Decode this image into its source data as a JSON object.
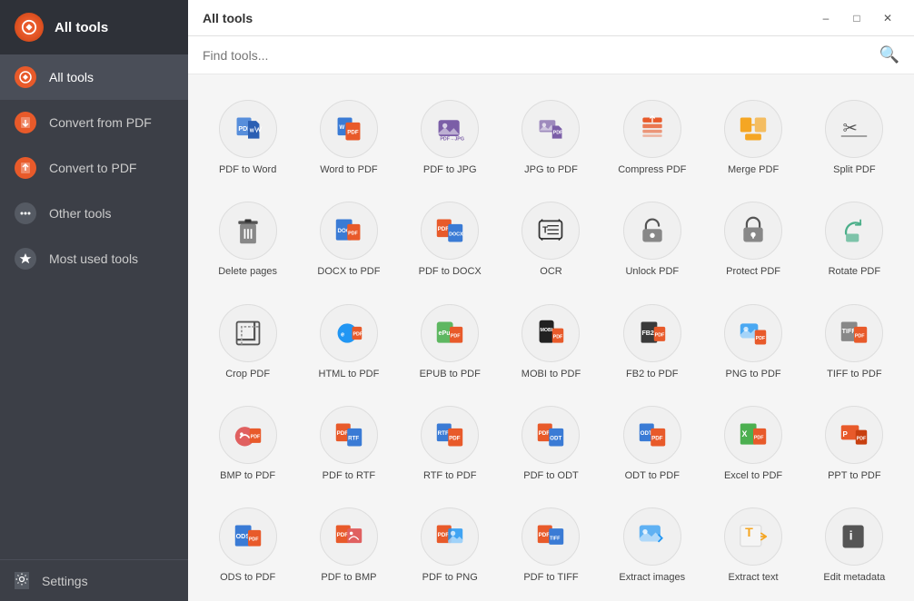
{
  "sidebar": {
    "logo_text": "All tools",
    "items": [
      {
        "id": "all-tools",
        "label": "All tools",
        "active": true
      },
      {
        "id": "convert-from-pdf",
        "label": "Convert from PDF",
        "active": false
      },
      {
        "id": "convert-to-pdf",
        "label": "Convert to PDF",
        "active": false
      },
      {
        "id": "other-tools",
        "label": "Other tools",
        "active": false
      },
      {
        "id": "most-used-tools",
        "label": "Most used tools",
        "active": false
      }
    ],
    "settings_label": "Settings"
  },
  "titlebar": {
    "title": "All tools",
    "minimize": "–",
    "maximize": "□",
    "close": "✕"
  },
  "search": {
    "placeholder": "Find tools..."
  },
  "tools": [
    {
      "id": "pdf-to-word",
      "label": "PDF to Word",
      "color": "#3a7bd5"
    },
    {
      "id": "word-to-pdf",
      "label": "Word to PDF",
      "color": "#3a7bd5"
    },
    {
      "id": "pdf-to-jpg",
      "label": "PDF to JPG",
      "color": "#7b5ea7"
    },
    {
      "id": "jpg-to-pdf",
      "label": "JPG to PDF",
      "color": "#7b5ea7"
    },
    {
      "id": "compress-pdf",
      "label": "Compress PDF",
      "color": "#e85a2a"
    },
    {
      "id": "merge-pdf",
      "label": "Merge PDF",
      "color": "#f5a623"
    },
    {
      "id": "split-pdf",
      "label": "Split PDF",
      "color": "#555"
    },
    {
      "id": "delete-pages",
      "label": "Delete pages",
      "color": "#555"
    },
    {
      "id": "docx-to-pdf",
      "label": "DOCX to PDF",
      "color": "#3a7bd5"
    },
    {
      "id": "pdf-to-docx",
      "label": "PDF to DOCX",
      "color": "#3a7bd5"
    },
    {
      "id": "ocr",
      "label": "OCR",
      "color": "#333"
    },
    {
      "id": "unlock-pdf",
      "label": "Unlock PDF",
      "color": "#555"
    },
    {
      "id": "protect-pdf",
      "label": "Protect PDF",
      "color": "#555"
    },
    {
      "id": "rotate-pdf",
      "label": "Rotate PDF",
      "color": "#4caf8a"
    },
    {
      "id": "crop-pdf",
      "label": "Crop PDF",
      "color": "#555"
    },
    {
      "id": "html-to-pdf",
      "label": "HTML to PDF",
      "color": "#2196f3"
    },
    {
      "id": "epub-to-pdf",
      "label": "EPUB to PDF",
      "color": "#4caf50"
    },
    {
      "id": "mobi-to-pdf",
      "label": "MOBI to PDF",
      "color": "#222"
    },
    {
      "id": "fb2-to-pdf",
      "label": "FB2 to PDF",
      "color": "#333"
    },
    {
      "id": "png-to-pdf",
      "label": "PNG to PDF",
      "color": "#2196f3"
    },
    {
      "id": "tiff-to-pdf",
      "label": "TIFF to PDF",
      "color": "#555"
    },
    {
      "id": "bmp-to-pdf",
      "label": "BMP to PDF",
      "color": "#e85a2a"
    },
    {
      "id": "pdf-to-rtf",
      "label": "PDF to RTF",
      "color": "#3a7bd5"
    },
    {
      "id": "rtf-to-pdf",
      "label": "RTF to PDF",
      "color": "#3a7bd5"
    },
    {
      "id": "pdf-to-odt",
      "label": "PDF to ODT",
      "color": "#3a7bd5"
    },
    {
      "id": "odt-to-pdf",
      "label": "ODT to PDF",
      "color": "#3a7bd5"
    },
    {
      "id": "excel-to-pdf",
      "label": "Excel to PDF",
      "color": "#4caf50"
    },
    {
      "id": "ppt-to-pdf",
      "label": "PPT to PDF",
      "color": "#e85a2a"
    },
    {
      "id": "ods-to-pdf",
      "label": "ODS to PDF",
      "color": "#3a7bd5"
    },
    {
      "id": "pdf-to-bmp",
      "label": "PDF to BMP",
      "color": "#e85a2a"
    },
    {
      "id": "pdf-to-png",
      "label": "PDF to PNG",
      "color": "#2196f3"
    },
    {
      "id": "pdf-to-tiff",
      "label": "PDF to TIFF",
      "color": "#3a7bd5"
    },
    {
      "id": "extract-images",
      "label": "Extract images",
      "color": "#2196f3"
    },
    {
      "id": "extract-text",
      "label": "Extract text",
      "color": "#f5a623"
    },
    {
      "id": "edit-metadata",
      "label": "Edit metadata",
      "color": "#555"
    }
  ]
}
